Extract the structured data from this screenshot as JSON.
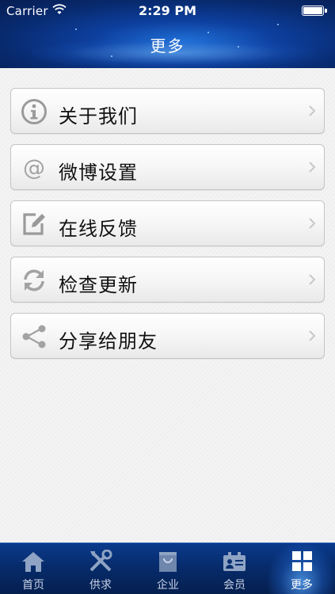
{
  "status_bar": {
    "carrier": "Carrier",
    "time": "2:29 PM"
  },
  "header": {
    "title": "更多"
  },
  "menu": {
    "items": [
      {
        "label": "关于我们",
        "icon": "info-icon"
      },
      {
        "label": "微博设置",
        "icon": "at-sign-icon"
      },
      {
        "label": "在线反馈",
        "icon": "edit-icon"
      },
      {
        "label": "检查更新",
        "icon": "refresh-icon"
      },
      {
        "label": "分享给朋友",
        "icon": "share-icon"
      }
    ]
  },
  "tabbar": {
    "tabs": [
      {
        "label": "首页",
        "icon": "home-icon"
      },
      {
        "label": "供求",
        "icon": "tools-icon"
      },
      {
        "label": "企业",
        "icon": "shopping-bag-icon"
      },
      {
        "label": "会员",
        "icon": "member-card-icon"
      },
      {
        "label": "更多",
        "icon": "grid-icon"
      }
    ],
    "active_index": 4
  },
  "colors": {
    "header_bg": "#0d3f9e",
    "tabbar_bg": "#072c6c",
    "icon_gray": "#9a9a9a"
  }
}
